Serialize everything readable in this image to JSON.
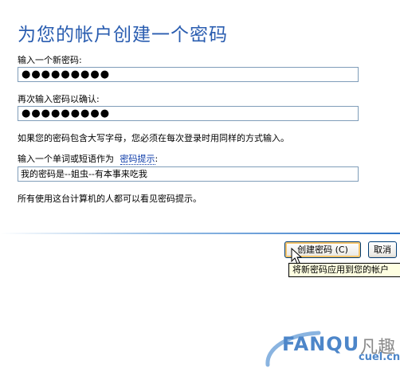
{
  "header": {
    "title": "为您的帐户创建一个密码"
  },
  "form": {
    "new_password_label": "输入一个新密码:",
    "new_password_value": "●●●●●●●●●",
    "confirm_label": "再次输入密码以确认:",
    "confirm_value": "●●●●●●●●●",
    "case_note": "如果您的密码包含大写字母，您必须在每次登录时用同样的方式输入。",
    "hint_label": "输入一个单词或短语作为",
    "hint_link": "密码提示",
    "hint_colon": ":",
    "hint_value": "我的密码是--姐虫--有本事来吃我",
    "visibility_note": "所有使用这台计算机的人都可以看见密码提示。"
  },
  "buttons": {
    "create": "创建密码 (C)",
    "cancel": "取消"
  },
  "tooltip": {
    "text": "将新密码应用到您的帐户"
  },
  "watermark": {
    "brand": "FANQU",
    "brand_cn": "凡趣",
    "domain": "cuel.cn"
  },
  "colors": {
    "title": "#2a5db0",
    "link": "#0b3aa8",
    "field_border": "#7f9db9",
    "tooltip_bg": "#ffffe1"
  }
}
